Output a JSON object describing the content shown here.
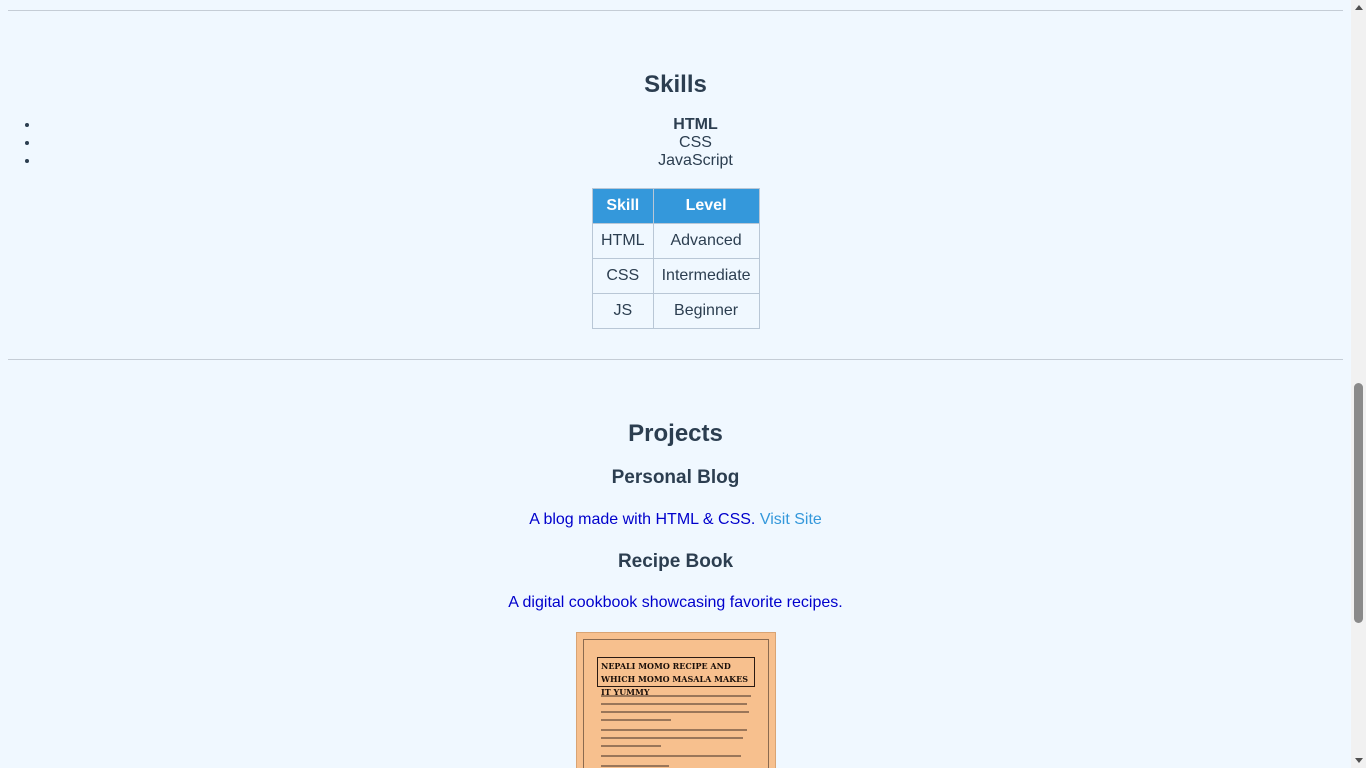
{
  "skills": {
    "heading": "Skills",
    "list": [
      "HTML",
      "CSS",
      "JavaScript"
    ],
    "table": {
      "headers": [
        "Skill",
        "Level"
      ],
      "rows": [
        [
          "HTML",
          "Advanced"
        ],
        [
          "CSS",
          "Intermediate"
        ],
        [
          "JS",
          "Beginner"
        ]
      ]
    }
  },
  "projects": {
    "heading": "Projects",
    "items": [
      {
        "title": "Personal Blog",
        "description": "A blog made with HTML & CSS.",
        "link_label": "Visit Site"
      },
      {
        "title": "Recipe Book",
        "description": "A digital cookbook showcasing favorite recipes.",
        "image_caption": "NEPALI MOMO RECIPE AND WHICH MOMO MASALA MAKES IT YUMMY"
      }
    ]
  },
  "colors": {
    "background": "#f0f8ff",
    "table_header": "#3498db",
    "heading_text": "#2c3e50",
    "description_text": "#0000cc",
    "link": "#3498db"
  }
}
